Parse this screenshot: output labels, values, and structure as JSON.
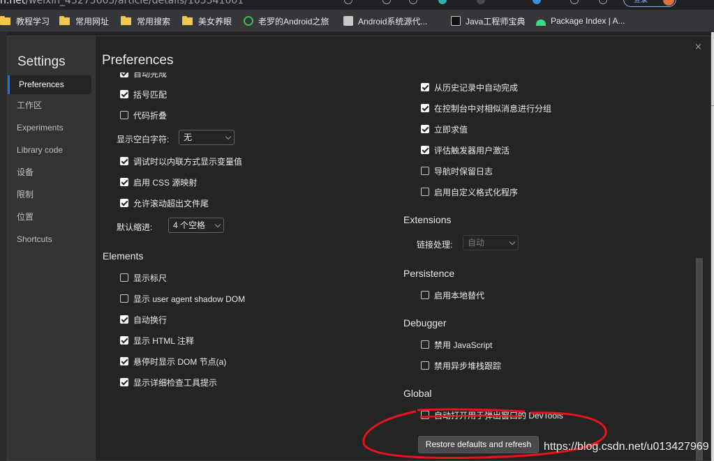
{
  "browser": {
    "url_host": "n.net",
    "url_path": "/weixin_43275605/article/details/105341001",
    "account_label": "登录",
    "bookmarks": [
      {
        "label": "教程学习",
        "icon": "folder-icon"
      },
      {
        "label": "常用网址",
        "icon": "folder-icon"
      },
      {
        "label": "常用搜索",
        "icon": "folder-icon"
      },
      {
        "label": "美女养眼",
        "icon": "folder-icon"
      },
      {
        "label": "老罗的Android之旅",
        "icon": "site-icon"
      },
      {
        "label": "Android系统源代...",
        "icon": "site-icon"
      },
      {
        "label": "Java工程师宝典",
        "icon": "site-icon"
      },
      {
        "label": "Package Index | A...",
        "icon": "android-icon"
      }
    ]
  },
  "settings": {
    "title": "Settings",
    "close_glyph": "×",
    "nav": [
      "Preferences",
      "工作区",
      "Experiments",
      "Library code",
      "设备",
      "限制",
      "位置",
      "Shortcuts"
    ],
    "active_nav": "Preferences",
    "content_title": "Preferences",
    "left_column": {
      "partial_item": "自动完成",
      "items_top": [
        {
          "label": "括号匹配",
          "checked": true
        },
        {
          "label": "代码折叠",
          "checked": false
        }
      ],
      "whitespace_label": "显示空白字符:",
      "whitespace_value": "无",
      "items_mid": [
        {
          "label": "调试时以内联方式显示变量值",
          "checked": true
        },
        {
          "label": "启用 CSS 源映射",
          "checked": true
        },
        {
          "label": "允许滚动超出文件尾",
          "checked": true
        }
      ],
      "indent_label": "默认缩进:",
      "indent_value": "4 个空格",
      "elements_title": "Elements",
      "elements_items": [
        {
          "label": "显示标尺",
          "checked": false
        },
        {
          "label": "显示 user agent shadow DOM",
          "checked": false
        },
        {
          "label": "自动换行",
          "checked": true
        },
        {
          "label": "显示 HTML 注释",
          "checked": true
        },
        {
          "label": "悬停时显示 DOM 节点(a)",
          "checked": true
        },
        {
          "label": "显示详细检查工具提示",
          "checked": true
        }
      ]
    },
    "right_column": {
      "console_items": [
        {
          "label": "从历史记录中自动完成",
          "checked": true
        },
        {
          "label": "在控制台中对相似消息进行分组",
          "checked": true
        },
        {
          "label": "立即求值",
          "checked": true
        },
        {
          "label": "评估触发器用户激活",
          "checked": true
        },
        {
          "label": "导航时保留日志",
          "checked": false
        },
        {
          "label": "启用自定义格式化程序",
          "checked": false
        }
      ],
      "extensions_title": "Extensions",
      "link_handling_label": "链接处理:",
      "link_handling_value": "自动",
      "persistence_title": "Persistence",
      "persistence_items": [
        {
          "label": "启用本地替代",
          "checked": false
        }
      ],
      "debugger_title": "Debugger",
      "debugger_items": [
        {
          "label": "禁用 JavaScript",
          "checked": false
        },
        {
          "label": "禁用异步堆栈跟踪",
          "checked": false
        }
      ],
      "global_title": "Global",
      "global_items": [
        {
          "label": "自动打开用于弹出窗口的 DevTools",
          "checked": false
        }
      ]
    },
    "restore_button": "Restore defaults and refresh"
  },
  "annotation": {
    "watermark": "https://blog.csdn.net/u013427969",
    "scribble_color": "#e8141c"
  }
}
